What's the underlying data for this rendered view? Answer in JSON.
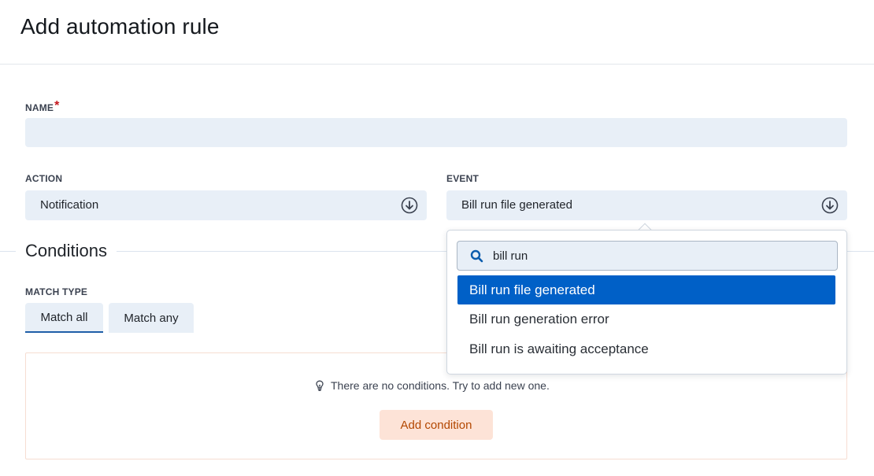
{
  "page": {
    "title": "Add automation rule"
  },
  "form": {
    "name": {
      "label": "NAME",
      "required_mark": "*",
      "value": ""
    },
    "action": {
      "label": "ACTION",
      "value": "Notification",
      "icon": "circle-arrow-down-icon"
    },
    "event": {
      "label": "EVENT",
      "value": "Bill run file generated",
      "icon": "circle-arrow-down-icon"
    }
  },
  "conditions": {
    "title": "Conditions",
    "match_type": {
      "label": "MATCH TYPE",
      "options": [
        {
          "label": "Match all",
          "active": true
        },
        {
          "label": "Match any",
          "active": false
        }
      ]
    },
    "empty_message": "There are no conditions. Try to add new one.",
    "empty_icon": "lightbulb-icon",
    "add_button": "Add condition"
  },
  "event_dropdown": {
    "search_value": "bill run",
    "search_icon": "search-icon",
    "options": [
      {
        "label": "Bill run file generated",
        "selected": true
      },
      {
        "label": "Bill run generation error",
        "selected": false
      },
      {
        "label": "Bill run is awaiting acceptance",
        "selected": false
      }
    ]
  },
  "colors": {
    "accent": "#0060c7",
    "field_bg": "#e8eff7",
    "add_button_bg": "#fde3d7",
    "add_button_text": "#b34700",
    "required": "#c4161c"
  }
}
